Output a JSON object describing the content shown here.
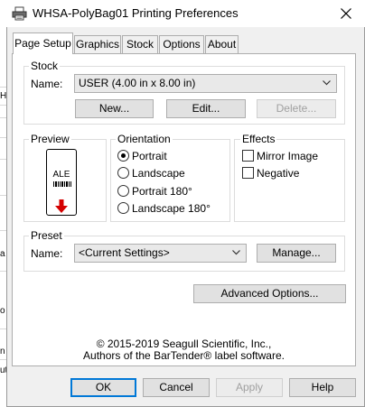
{
  "backdrop": {
    "fragments": [
      "H",
      "a",
      "o",
      "n",
      "ut"
    ]
  },
  "window": {
    "title": "WHSA-PolyBag01 Printing Preferences"
  },
  "tabs": [
    {
      "label": "Page Setup",
      "active": true
    },
    {
      "label": "Graphics",
      "active": false
    },
    {
      "label": "Stock",
      "active": false
    },
    {
      "label": "Options",
      "active": false
    },
    {
      "label": "About",
      "active": false
    }
  ],
  "stock": {
    "group_label": "Stock",
    "name_label": "Name:",
    "name_value": "USER (4.00 in x 8.00 in)",
    "new_label": "New...",
    "edit_label": "Edit...",
    "delete_label": "Delete..."
  },
  "preview": {
    "group_label": "Preview",
    "sample_text": "ALE"
  },
  "orientation": {
    "group_label": "Orientation",
    "options": [
      {
        "label": "Portrait",
        "selected": true
      },
      {
        "label": "Landscape",
        "selected": false
      },
      {
        "label": "Portrait 180°",
        "selected": false
      },
      {
        "label": "Landscape 180°",
        "selected": false
      }
    ]
  },
  "effects": {
    "group_label": "Effects",
    "options": [
      {
        "label": "Mirror Image",
        "checked": false
      },
      {
        "label": "Negative",
        "checked": false
      }
    ]
  },
  "preset": {
    "group_label": "Preset",
    "name_label": "Name:",
    "name_value": "<Current Settings>",
    "manage_label": "Manage..."
  },
  "advanced_label": "Advanced Options...",
  "copyright": {
    "line1": "© 2015-2019 Seagull Scientific, Inc.,",
    "line2": "Authors of the BarTender® label software."
  },
  "footer": {
    "ok_label": "OK",
    "cancel_label": "Cancel",
    "apply_label": "Apply",
    "help_label": "Help"
  },
  "colors": {
    "accent": "#0078d7",
    "preview_arrow": "#d40000"
  }
}
